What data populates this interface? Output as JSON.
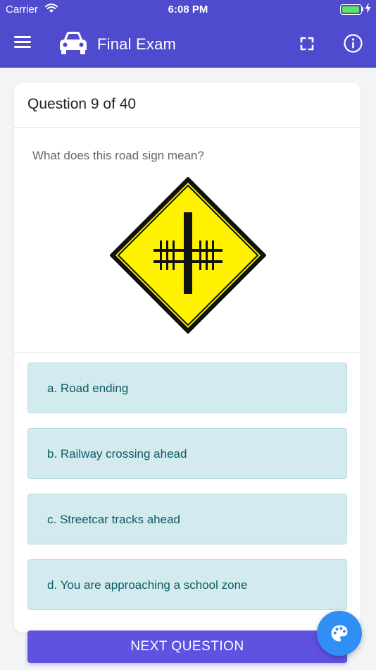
{
  "status_bar": {
    "carrier": "Carrier",
    "time": "6:08 PM",
    "battery_level": 1.0
  },
  "header": {
    "title": "Final Exam",
    "menu_icon": "hamburger-menu-icon",
    "logo_icon": "car-icon",
    "fullscreen_icon": "fullscreen-icon",
    "info_icon": "info-icon"
  },
  "question": {
    "counter": "Question 9 of 40",
    "text": "What does this road sign mean?",
    "image_icon": "railway-crossing-sign-icon"
  },
  "options": [
    {
      "label": "a. Road ending"
    },
    {
      "label": "b. Railway crossing ahead"
    },
    {
      "label": "c. Streetcar tracks ahead"
    },
    {
      "label": "d. You are approaching a school zone"
    }
  ],
  "footer": {
    "next_label": "NEXT QUESTION",
    "fab_icon": "palette-icon"
  },
  "colors": {
    "header_bg": "#4f4bce",
    "option_bg": "#d3ebef",
    "option_text": "#0d5a66",
    "next_button": "#5f52e0",
    "fab": "#2f8ff4",
    "sign_yellow": "#fff200"
  }
}
